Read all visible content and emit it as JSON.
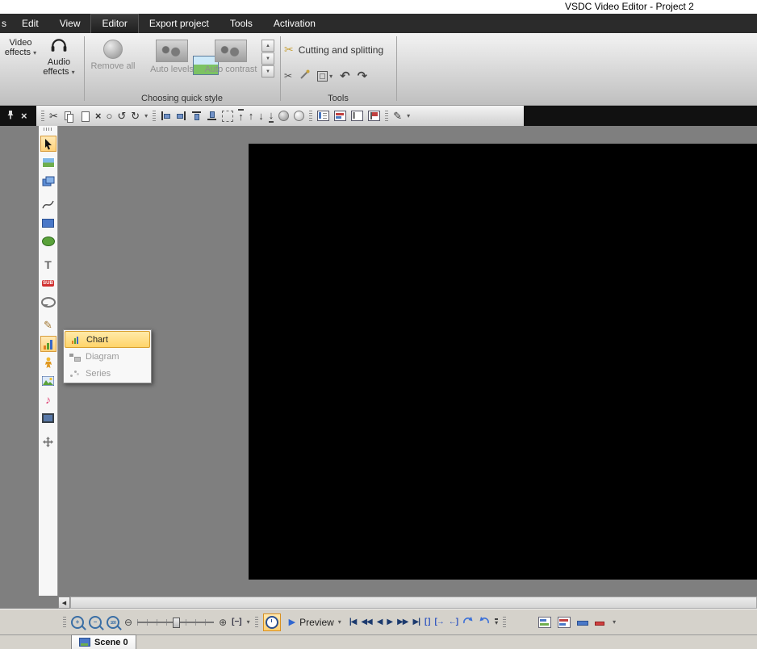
{
  "window": {
    "title": "VSDC Video Editor - Project 2"
  },
  "menubar": {
    "truncated_left": "s",
    "items": [
      {
        "label": "Edit"
      },
      {
        "label": "View"
      },
      {
        "label": "Editor"
      },
      {
        "label": "Export project"
      },
      {
        "label": "Tools"
      },
      {
        "label": "Activation"
      }
    ],
    "active_item": "Editor"
  },
  "ribbon": {
    "video_effects": "Video effects",
    "audio_effects": "Audio effects",
    "remove_all": "Remove all",
    "auto_levels": "Auto levels",
    "auto_contrast": "Auto contrast",
    "cutting_and_splitting": "Cutting and splitting",
    "group_quick_style": "Choosing quick style",
    "group_tools": "Tools"
  },
  "context_menu": {
    "items": [
      {
        "label": "Chart",
        "enabled": true
      },
      {
        "label": "Diagram",
        "enabled": false
      },
      {
        "label": "Series",
        "enabled": false
      }
    ]
  },
  "transport": {
    "preview": "Preview"
  },
  "zoom_controls": {
    "zoom_100_label": "100"
  },
  "scene_tab": {
    "label": "Scene 0"
  },
  "icons": {
    "dropdown": "▾",
    "spinner_up": "▲",
    "spinner_down": "▼",
    "cut": "✂",
    "close": "×",
    "delete": "×",
    "deselect_circle": "○",
    "undo": "↺",
    "redo": "↻",
    "rotate_ccw": "↶",
    "rotate_cw": "↷",
    "arrow_up": "↑",
    "arrow_down": "↓",
    "pencil": "✎",
    "music_note": "♪",
    "text_tool": "T",
    "subtitle_tool": "SUB",
    "lens_plus": "+",
    "lens_minus": "−",
    "minus_circle": "⊖",
    "plus_circle": "⊕",
    "fit_brackets": "[−]",
    "to_start": "|◀",
    "rewind": "◀◀",
    "frame_back": "◀",
    "play": "▶",
    "forward": "▶▶",
    "to_end": "▶|",
    "bracket_set": "[ ]",
    "bracket_start": "[→",
    "bracket_end": "←]",
    "left_scroll": "◀"
  },
  "colors": {
    "menu_bg": "#2b2b2b",
    "canvas_gray": "#7f7f7f",
    "video_black": "#000000",
    "selection_orange": "#ffd27a",
    "selection_border": "#d89c3c",
    "media_navy": "#1c3a6e",
    "accent_blue": "#3a6ea5"
  }
}
